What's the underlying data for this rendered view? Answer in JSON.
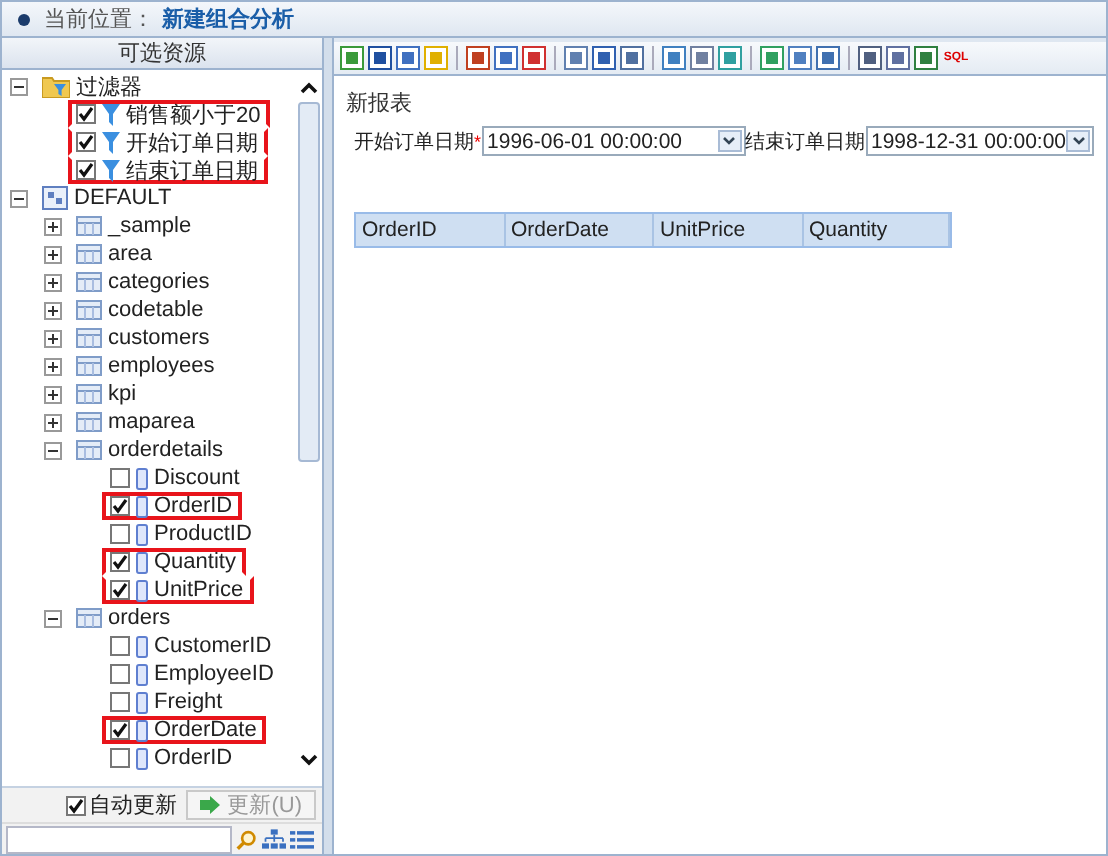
{
  "location": {
    "label": "当前位置：",
    "value": "新建组合分析"
  },
  "sidebar": {
    "title": "可选资源",
    "tree": [
      {
        "kind": "folder",
        "label": "过滤器",
        "expanded": true,
        "children": [
          {
            "kind": "filter",
            "label": "销售额小于20",
            "checked": true,
            "highlighted": true
          },
          {
            "kind": "filter",
            "label": "开始订单日期",
            "checked": true,
            "highlighted": true
          },
          {
            "kind": "filter",
            "label": "结束订单日期",
            "checked": true,
            "highlighted": true
          }
        ]
      },
      {
        "kind": "database",
        "label": "DEFAULT",
        "expanded": true,
        "children": [
          {
            "kind": "table",
            "label": "_sample",
            "expanded": false
          },
          {
            "kind": "table",
            "label": "area",
            "expanded": false
          },
          {
            "kind": "table",
            "label": "categories",
            "expanded": false
          },
          {
            "kind": "table",
            "label": "codetable",
            "expanded": false
          },
          {
            "kind": "table",
            "label": "customers",
            "expanded": false
          },
          {
            "kind": "table",
            "label": "employees",
            "expanded": false
          },
          {
            "kind": "table",
            "label": "kpi",
            "expanded": false
          },
          {
            "kind": "table",
            "label": "maparea",
            "expanded": false
          },
          {
            "kind": "table",
            "label": "orderdetails",
            "expanded": true,
            "children": [
              {
                "kind": "field",
                "label": "Discount",
                "checked": false,
                "highlighted": false
              },
              {
                "kind": "field",
                "label": "OrderID",
                "checked": true,
                "highlighted": true
              },
              {
                "kind": "field",
                "label": "ProductID",
                "checked": false,
                "highlighted": false
              },
              {
                "kind": "field",
                "label": "Quantity",
                "checked": true,
                "highlighted": true
              },
              {
                "kind": "field",
                "label": "UnitPrice",
                "checked": true,
                "highlighted": true
              }
            ]
          },
          {
            "kind": "table",
            "label": "orders",
            "expanded": true,
            "children": [
              {
                "kind": "field",
                "label": "CustomerID",
                "checked": false,
                "highlighted": false
              },
              {
                "kind": "field",
                "label": "EmployeeID",
                "checked": false,
                "highlighted": false
              },
              {
                "kind": "field",
                "label": "Freight",
                "checked": false,
                "highlighted": false
              },
              {
                "kind": "field",
                "label": "OrderDate",
                "checked": true,
                "highlighted": true
              },
              {
                "kind": "field",
                "label": "OrderID",
                "checked": false,
                "highlighted": false
              }
            ]
          }
        ]
      }
    ],
    "auto_update": {
      "label": "自动更新",
      "checked": true
    },
    "update_button": {
      "label": "更新(U)",
      "disabled": true
    }
  },
  "toolbar": {
    "sql_icon_text": "SQL"
  },
  "report": {
    "title": "新报表",
    "filters": [
      {
        "label": "开始订单日期",
        "required_mark": "*",
        "value": "1996-06-01 00:00:00"
      },
      {
        "label": "结束订单日期",
        "value": "1998-12-31 00:00:00"
      }
    ],
    "table": {
      "columns": [
        "OrderID",
        "OrderDate",
        "UnitPrice",
        "Quantity"
      ]
    }
  }
}
